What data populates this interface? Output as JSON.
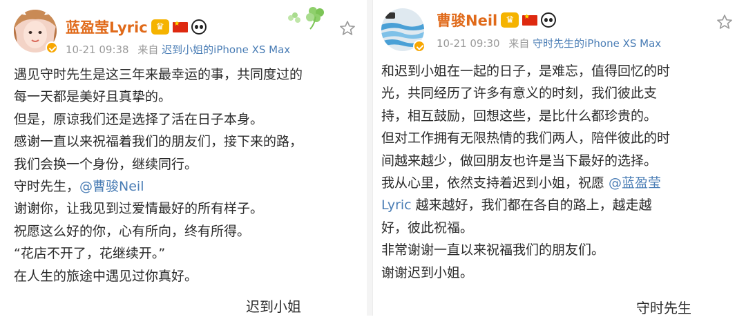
{
  "left_post": {
    "author": "蓝盈莹Lyric",
    "date": "10-21 09:38",
    "source_prefix": "来自",
    "source": "迟到小姐的iPhone XS Max",
    "lines": [
      {
        "text": "遇见守时先生是这三年来最幸运的事，共同度过的"
      },
      {
        "text": "每一天都是美好且真挚的。"
      },
      {
        "text": "但是，原谅我们还是选择了活在日子本身。"
      },
      {
        "text": "感谢一直以来祝福着我们的朋友们，接下来的路，"
      },
      {
        "text": "我们会换一个身份，继续同行。"
      },
      {
        "prefix": "守时先生，",
        "mention": "@曹骏Neil"
      },
      {
        "text": "谢谢你，让我见到过爱情最好的所有样子。"
      },
      {
        "text": "祝愿这么好的你，心有所向，终有所得。"
      },
      {
        "text": "“花店不开了，花继续开。”"
      },
      {
        "text": "在人生的旅途中遇见过你真好。"
      }
    ],
    "signature": "迟到小姐"
  },
  "right_post": {
    "author": "曹骏Neil",
    "date": "10-21 09:30",
    "source_prefix": "来自",
    "source": "守时先生的iPhone XS Max",
    "lines": [
      {
        "text": "和迟到小姐在一起的日子，是难忘，值得回忆的时"
      },
      {
        "text": "光，共同经历了许多有意义的时刻，我们彼此支"
      },
      {
        "text": "持，相互鼓励，回想这些，是比什么都珍贵的。"
      },
      {
        "text": "但对工作拥有无限热情的我们两人，陪伴彼此的时"
      },
      {
        "text": "间越来越少，做回朋友也许是当下最好的选择。"
      },
      {
        "prefix": "我从心里，依然支持着迟到小姐，祝愿 ",
        "mention": "@蓝盈莹"
      },
      {
        "mention": "Lyric",
        "suffix": " 越来越好，我们都在各自的路上，越走越"
      },
      {
        "text": "好，彼此祝福。"
      },
      {
        "text": "非常谢谢一直以来祝福我们的朋友们。"
      },
      {
        "text": "谢谢迟到小姐。"
      }
    ],
    "signature": "守时先生"
  },
  "colors": {
    "author_name": "#e06a1a",
    "link": "#4a7db5",
    "meta_gray": "#9a9a9a",
    "verified_badge": "#f7a600"
  },
  "icons": [
    "avatar",
    "verified-badge-icon",
    "vip-crown-icon",
    "china-flag-icon",
    "panda-icon",
    "favorite-star-icon",
    "clover-decoration-icon"
  ]
}
